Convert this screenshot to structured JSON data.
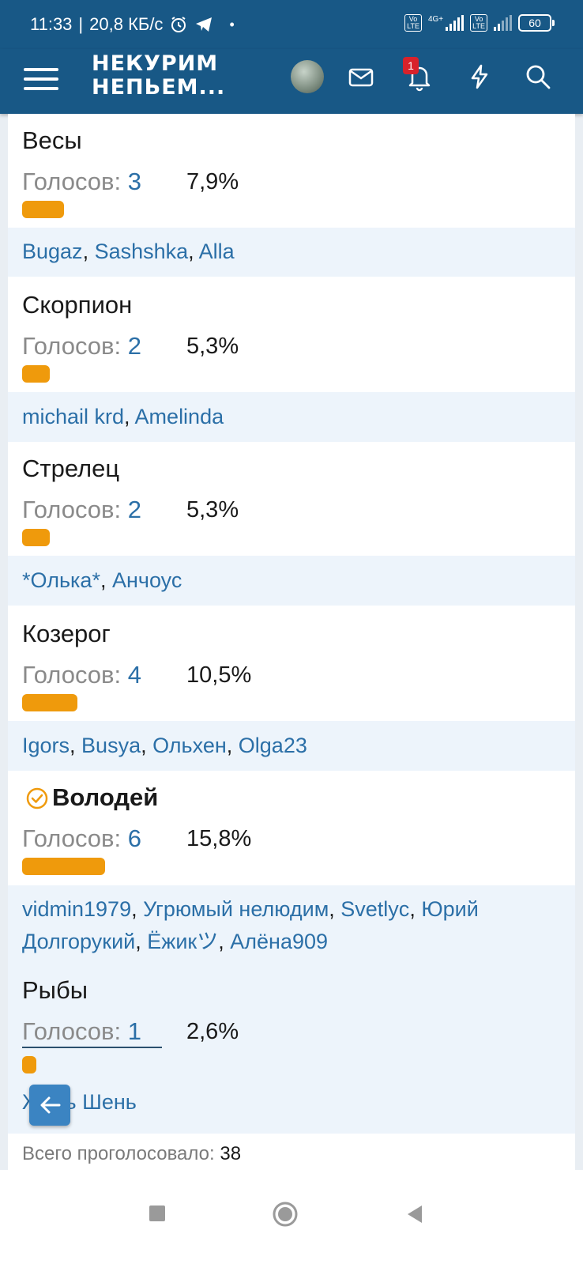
{
  "status_bar": {
    "time": "11:33",
    "speed": "20,8 КБ/с",
    "battery": "60",
    "volte": "Vo\nLTE",
    "network": "4G+"
  },
  "header": {
    "logo_line1": "НЕКУРИМ",
    "logo_line2": "НЕПЬЕМ...",
    "notifications_count": "1"
  },
  "poll": {
    "votes_label": "Голосов: ",
    "options": [
      {
        "name": "Весы",
        "votes": "3",
        "percent": "7,9%",
        "share": 0.079,
        "voters": [
          "Bugaz",
          "Sashshka",
          "Alla"
        ]
      },
      {
        "name": "Скорпион",
        "votes": "2",
        "percent": "5,3%",
        "share": 0.053,
        "voters": [
          "michail krd",
          "Amelinda"
        ]
      },
      {
        "name": "Стрелец",
        "votes": "2",
        "percent": "5,3%",
        "share": 0.053,
        "voters": [
          "*Олька*",
          "Анчоус"
        ]
      },
      {
        "name": "Козерог",
        "votes": "4",
        "percent": "10,5%",
        "share": 0.105,
        "voters": [
          "Igors",
          "Busya",
          "Ольхен",
          "Olga23"
        ]
      },
      {
        "name": "Володей",
        "votes": "6",
        "percent": "15,8%",
        "share": 0.158,
        "selected": true,
        "voters": [
          "vidmin1979",
          "Угрюмый нелюдим",
          "Svetlyc",
          "Юрий Долгорукий",
          "Ёжикツ",
          "Алёна909"
        ]
      },
      {
        "name": "Рыбы",
        "votes": "1",
        "percent": "2,6%",
        "share": 0.026,
        "voters": [
          "Жень Шень"
        ]
      }
    ],
    "total_label": "Всего проголосовало: ",
    "total_value": "38"
  },
  "colors": {
    "header": "#185886",
    "bar": "#ef9a0c",
    "link": "#2b6fa7",
    "voters_bg": "#edf4fb"
  }
}
